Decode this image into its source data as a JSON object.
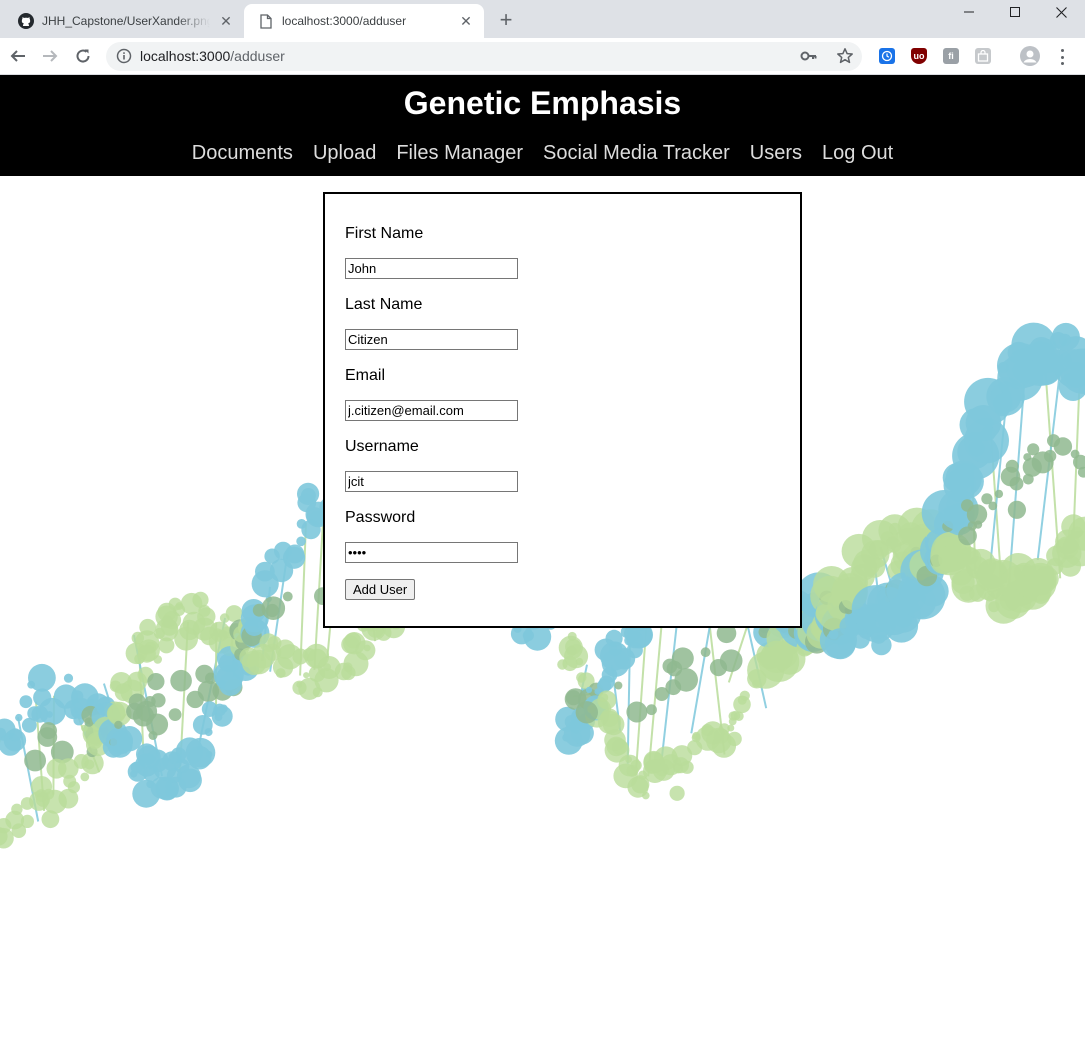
{
  "browser": {
    "tabs": [
      {
        "title": "JHH_Capstone/UserXander.png at",
        "icon": "github-icon",
        "active": false
      },
      {
        "title": "localhost:3000/adduser",
        "icon": "document-icon",
        "active": true
      }
    ],
    "new_tab_symbol": "+",
    "close_symbol": "✕",
    "window_controls": {
      "minimize": "−",
      "maximize": "☐",
      "close": "✕"
    },
    "url_host": "localhost:3000",
    "url_path": "/adduser",
    "extensions": [
      {
        "icon": "clock-extension-icon",
        "color": "#1a73e8"
      },
      {
        "icon": "ublock-origin-icon",
        "color": "#800000"
      },
      {
        "icon": "puzzle-extension-icon",
        "color": "#9aa0a6"
      },
      {
        "icon": "bag-extension-icon",
        "color": "#bdc1c6"
      }
    ]
  },
  "site": {
    "title": "Genetic Emphasis",
    "nav": [
      "Documents",
      "Upload",
      "Files Manager",
      "Social Media Tracker",
      "Users",
      "Log Out"
    ]
  },
  "form": {
    "first_name": {
      "label": "First Name",
      "value": "John"
    },
    "last_name": {
      "label": "Last Name",
      "value": "Citizen"
    },
    "email": {
      "label": "Email",
      "value": "j.citizen@email.com"
    },
    "username": {
      "label": "Username",
      "value": "jcit"
    },
    "password": {
      "label": "Password",
      "value": "••••"
    },
    "submit_label": "Add User"
  },
  "colors": {
    "header_bg": "#000000",
    "helix_blue": "#7ec8dc",
    "helix_green": "#b9dc9a",
    "helix_overlap": "#8fb88f"
  }
}
